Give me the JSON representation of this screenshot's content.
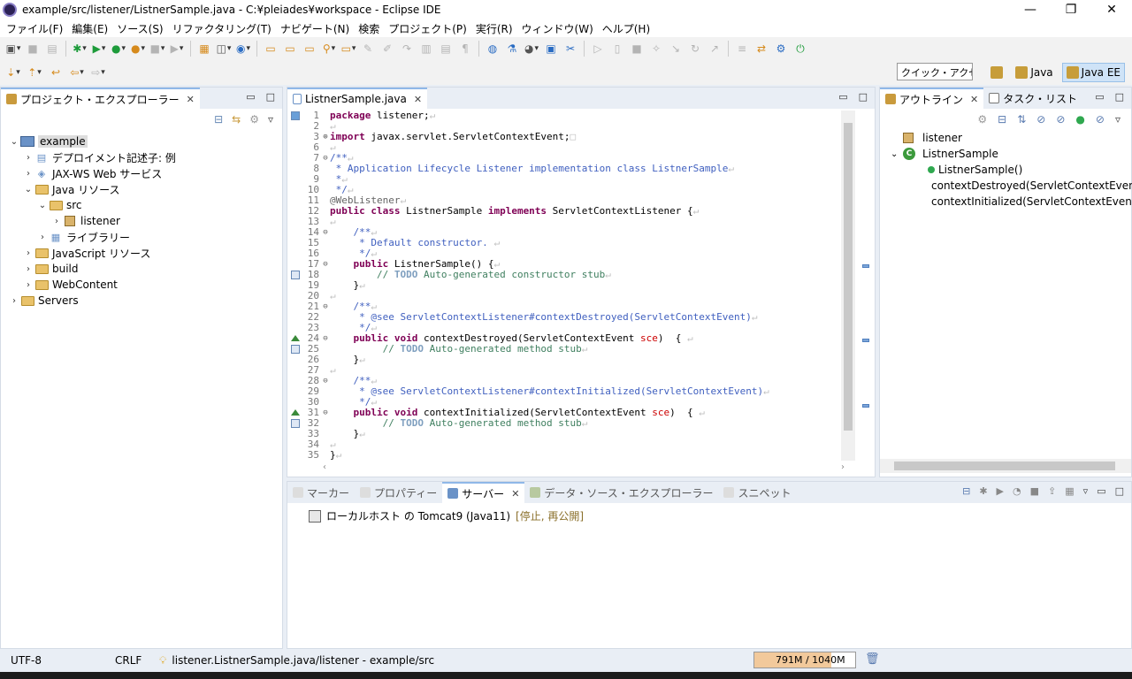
{
  "window": {
    "title": "example/src/listener/ListnerSample.java - C:¥pleiades¥workspace - Eclipse IDE",
    "controls": [
      "—",
      "❐",
      "✕"
    ]
  },
  "menu": [
    "ファイル(F)",
    "編集(E)",
    "ソース(S)",
    "リファクタリング(T)",
    "ナビゲート(N)",
    "検索",
    "プロジェクト(P)",
    "実行(R)",
    "ウィンドウ(W)",
    "ヘルプ(H)"
  ],
  "quick_access": "クイック・アクセス",
  "perspectives": [
    "Java",
    "Java EE"
  ],
  "explorer": {
    "tab": "プロジェクト・エクスプローラー",
    "items": [
      {
        "label": "example",
        "arrow": "⌄",
        "indent": 0,
        "icon": "project"
      },
      {
        "label": "デプロイメント記述子: 例",
        "arrow": "›",
        "indent": 1,
        "icon": "descriptor"
      },
      {
        "label": "JAX-WS Web サービス",
        "arrow": "›",
        "indent": 1,
        "icon": "webservice"
      },
      {
        "label": "Java リソース",
        "arrow": "⌄",
        "indent": 1,
        "icon": "javares"
      },
      {
        "label": "src",
        "arrow": "⌄",
        "indent": 2,
        "icon": "srcfolder"
      },
      {
        "label": "listener",
        "arrow": "›",
        "indent": 3,
        "icon": "package"
      },
      {
        "label": "ライブラリー",
        "arrow": "›",
        "indent": 2,
        "icon": "library"
      },
      {
        "label": "JavaScript リソース",
        "arrow": "›",
        "indent": 1,
        "icon": "jsres"
      },
      {
        "label": "build",
        "arrow": "›",
        "indent": 1,
        "icon": "folder"
      },
      {
        "label": "WebContent",
        "arrow": "›",
        "indent": 1,
        "icon": "folder"
      },
      {
        "label": "Servers",
        "arrow": "›",
        "indent": 0,
        "icon": "folder"
      }
    ]
  },
  "editor": {
    "tab": "ListnerSample.java",
    "lines": [
      {
        "n": "1",
        "html": "<span class='kw'>package</span> listener;<span class='ws'>↵</span>"
      },
      {
        "n": "2",
        "html": "<span class='ws'>↵</span>"
      },
      {
        "n": "3",
        "fold": "⊕",
        "html": "<span class='kw'>import</span> javax.servlet.ServletContextEvent;<span class='ws'>□</span>"
      },
      {
        "n": "6",
        "html": "<span class='ws'>↵</span>"
      },
      {
        "n": "7",
        "fold": "⊖",
        "html": "<span class='cm'>/**</span><span class='ws'>↵</span>"
      },
      {
        "n": "8",
        "html": "<span class='cm'> * Application Lifecycle Listener implementation class ListnerSample</span><span class='ws'>↵</span>"
      },
      {
        "n": "9",
        "html": "<span class='cm'> *</span><span class='ws'>↵</span>"
      },
      {
        "n": "10",
        "html": "<span class='cm'> */</span><span class='ws'>↵</span>"
      },
      {
        "n": "11",
        "html": "<span class='ann'>@WebListener</span><span class='ws'>↵</span>"
      },
      {
        "n": "12",
        "html": "<span class='kw'>public class</span> ListnerSample <span class='kw'>implements</span> ServletContextListener {<span class='ws'>↵</span>"
      },
      {
        "n": "13",
        "html": "<span class='ws'>↵</span>"
      },
      {
        "n": "14",
        "fold": "⊖",
        "html": "    <span class='cm'>/**</span><span class='ws'>↵</span>"
      },
      {
        "n": "15",
        "html": "<span class='cm'>     * Default constructor. </span><span class='ws'>↵</span>"
      },
      {
        "n": "16",
        "html": "<span class='cm'>     */</span><span class='ws'>↵</span>"
      },
      {
        "n": "17",
        "fold": "⊖",
        "html": "    <span class='kw'>public</span> ListnerSample() {<span class='ws'>↵</span>"
      },
      {
        "n": "18",
        "mark": "task",
        "html": "        <span class='cmt'>// </span><span class='todo'>TODO</span><span class='cmt'> Auto-generated constructor stub</span><span class='ws'>↵</span>"
      },
      {
        "n": "19",
        "html": "    }<span class='ws'>↵</span>"
      },
      {
        "n": "20",
        "html": "<span class='ws'>↵</span>"
      },
      {
        "n": "21",
        "fold": "⊖",
        "html": "    <span class='cm'>/**</span><span class='ws'>↵</span>"
      },
      {
        "n": "22",
        "html": "<span class='cm'>     * @see ServletContextListener#contextDestroyed(ServletContextEvent)</span><span class='ws'>↵</span>"
      },
      {
        "n": "23",
        "html": "<span class='cm'>     */</span><span class='ws'>↵</span>"
      },
      {
        "n": "24",
        "fold": "⊖",
        "mark": "override",
        "html": "    <span class='kw'>public void</span> contextDestroyed(ServletContextEvent <span class='id'>sce</span>)  { <span class='ws'>↵</span>"
      },
      {
        "n": "25",
        "mark": "task",
        "html": "         <span class='cmt'>// </span><span class='todo'>TODO</span><span class='cmt'> Auto-generated method stub</span><span class='ws'>↵</span>"
      },
      {
        "n": "26",
        "html": "    }<span class='ws'>↵</span>"
      },
      {
        "n": "27",
        "html": "<span class='ws'>↵</span>"
      },
      {
        "n": "28",
        "fold": "⊖",
        "html": "    <span class='cm'>/**</span><span class='ws'>↵</span>"
      },
      {
        "n": "29",
        "html": "<span class='cm'>     * @see ServletContextListener#contextInitialized(ServletContextEvent)</span><span class='ws'>↵</span>"
      },
      {
        "n": "30",
        "html": "<span class='cm'>     */</span><span class='ws'>↵</span>"
      },
      {
        "n": "31",
        "fold": "⊖",
        "mark": "override",
        "html": "    <span class='kw'>public void</span> contextInitialized(ServletContextEvent <span class='id'>sce</span>)  { <span class='ws'>↵</span>"
      },
      {
        "n": "32",
        "mark": "task",
        "html": "         <span class='cmt'>// </span><span class='todo'>TODO</span><span class='cmt'> Auto-generated method stub</span><span class='ws'>↵</span>"
      },
      {
        "n": "33",
        "html": "    }<span class='ws'>↵</span>"
      },
      {
        "n": "34",
        "html": "<span class='ws'>↵</span>"
      },
      {
        "n": "35",
        "html": "}<span class='ws'>↵</span>"
      }
    ]
  },
  "outline": {
    "tabs": [
      "アウトライン",
      "タスク・リスト"
    ],
    "items": [
      {
        "label": "listener",
        "indent": 0,
        "icon": "package"
      },
      {
        "label": "ListnerSample",
        "indent": 0,
        "icon": "class",
        "arrow": "⌄"
      },
      {
        "label": "ListnerSample()",
        "indent": 2,
        "icon": "constructor"
      },
      {
        "label": "contextDestroyed(ServletContextEvent) :",
        "indent": 2,
        "icon": "method"
      },
      {
        "label": "contextInitialized(ServletContextEvent) :",
        "indent": 2,
        "icon": "method"
      }
    ]
  },
  "bottom": {
    "tabs": [
      "マーカー",
      "プロパティー",
      "サーバー",
      "データ・ソース・エクスプローラー",
      "スニペット"
    ],
    "server": "ローカルホスト の Tomcat9 (Java11)",
    "server_state": "[停止, 再公開]"
  },
  "status": {
    "encoding": "UTF-8",
    "eol": "CRLF",
    "location": "listener.ListnerSample.java/listener - example/src",
    "heap": "791M / 1040M",
    "heap_fraction": 0.76
  }
}
